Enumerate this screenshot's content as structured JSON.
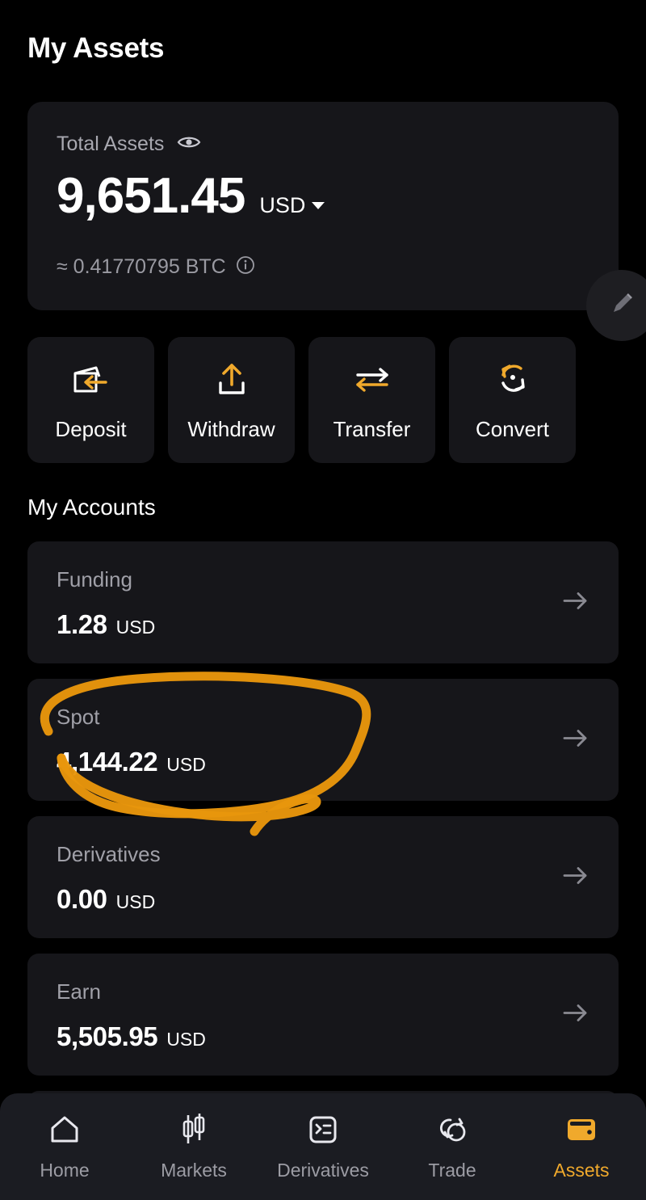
{
  "page": {
    "title": "My Assets"
  },
  "colors": {
    "background": "#000000",
    "card": "#16161a",
    "accent": "#f0a92c",
    "annotation": "#e8960c",
    "muted_text": "#a0a0a8",
    "nav_background": "#1b1c22"
  },
  "total_assets": {
    "label": "Total Assets",
    "visibility_icon": "eye-icon",
    "amount": "9,651.45",
    "currency": "USD",
    "currency_caret": "chevron-down-icon",
    "approx_value": "≈ 0.41770795 BTC",
    "info_icon": "info-icon"
  },
  "edit_button": {
    "icon": "pencil-icon"
  },
  "actions": [
    {
      "label": "Deposit",
      "icon": "wallet-deposit-icon"
    },
    {
      "label": "Withdraw",
      "icon": "upload-arrow-icon"
    },
    {
      "label": "Transfer",
      "icon": "transfer-arrows-icon"
    },
    {
      "label": "Convert",
      "icon": "convert-refresh-icon"
    }
  ],
  "accounts_section": {
    "title": "My Accounts",
    "rows": [
      {
        "name": "Funding",
        "amount": "1.28",
        "unit": "USD",
        "arrow": "arrow-right-icon"
      },
      {
        "name": "Spot",
        "amount": "4,144.22",
        "unit": "USD",
        "arrow": "arrow-right-icon"
      },
      {
        "name": "Derivatives",
        "amount": "0.00",
        "unit": "USD",
        "arrow": "arrow-right-icon"
      },
      {
        "name": "Earn",
        "amount": "5,505.95",
        "unit": "USD",
        "arrow": "arrow-right-icon"
      }
    ]
  },
  "bottom_nav": {
    "items": [
      {
        "label": "Home",
        "icon": "home-icon",
        "active": false
      },
      {
        "label": "Markets",
        "icon": "candlestick-icon",
        "active": false
      },
      {
        "label": "Derivatives",
        "icon": "list-panel-icon",
        "active": false
      },
      {
        "label": "Trade",
        "icon": "swap-circles-icon",
        "active": false
      },
      {
        "label": "Assets",
        "icon": "wallet-icon",
        "active": true
      }
    ]
  }
}
